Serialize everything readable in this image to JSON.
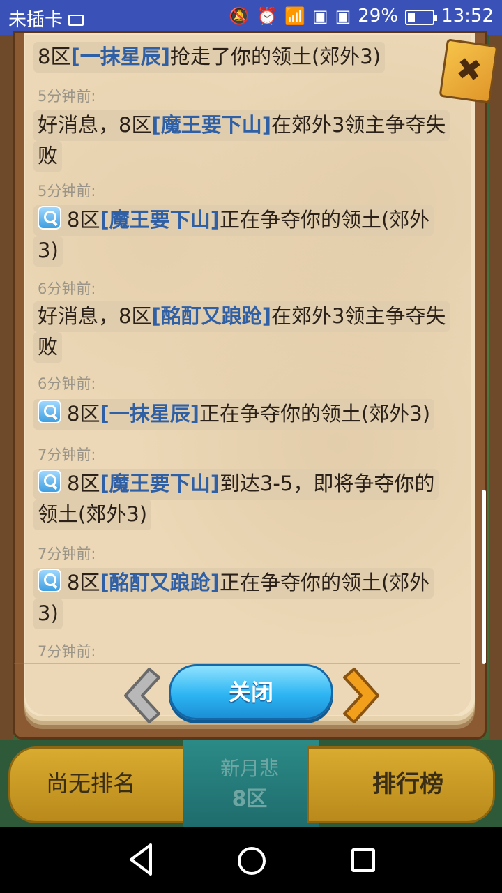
{
  "status_bar": {
    "carrier": "未插卡",
    "battery": "29%",
    "time": "13:52"
  },
  "messages": [
    {
      "text_before": "8区",
      "name": "[一抹星辰]",
      "text_after": "抢走了你的领土(郊外3)",
      "time": "5分钟前:",
      "has_icon": false
    },
    {
      "text_before": "好消息，8区",
      "name": "[魔王要下山]",
      "text_after": "在郊外3领主争夺失",
      "text_line2": "败",
      "time": "5分钟前:",
      "has_icon": false
    },
    {
      "text_before": "8区",
      "name": "[魔王要下山]",
      "text_after": "正在争夺你的领土(郊外",
      "text_line2": "3)",
      "time": "6分钟前:",
      "has_icon": true
    },
    {
      "text_before": "好消息，8区",
      "name": "[酩酊又踉跄]",
      "text_after": "在郊外3领主争夺失",
      "text_line2": "败",
      "time": "6分钟前:",
      "has_icon": false
    },
    {
      "text_before": "8区",
      "name": "[一抹星辰]",
      "text_after": "正在争夺你的领土(郊外3)",
      "time": "7分钟前:",
      "has_icon": true
    },
    {
      "text_before": "8区",
      "name": "[魔王要下山]",
      "text_after": "到达3-5，即将争夺你的",
      "text_line2": "领土(郊外3)",
      "time": "7分钟前:",
      "has_icon": true
    },
    {
      "text_before": "8区",
      "name": "[酩酊又踉跄]",
      "text_after": "正在争夺你的领土(郊外",
      "text_line2": "3)",
      "time": "7分钟前:",
      "has_icon": true
    }
  ],
  "buttons": {
    "close_label": "关闭"
  },
  "footer": {
    "no_rank": "尚无排名",
    "ranking": "排行榜",
    "player_name": "新月悲",
    "player_zone": "8区"
  },
  "colors": {
    "status_bar": "#3a52b8",
    "player_name_link": "#2f5fa5",
    "close_button": "#2db5f2"
  }
}
